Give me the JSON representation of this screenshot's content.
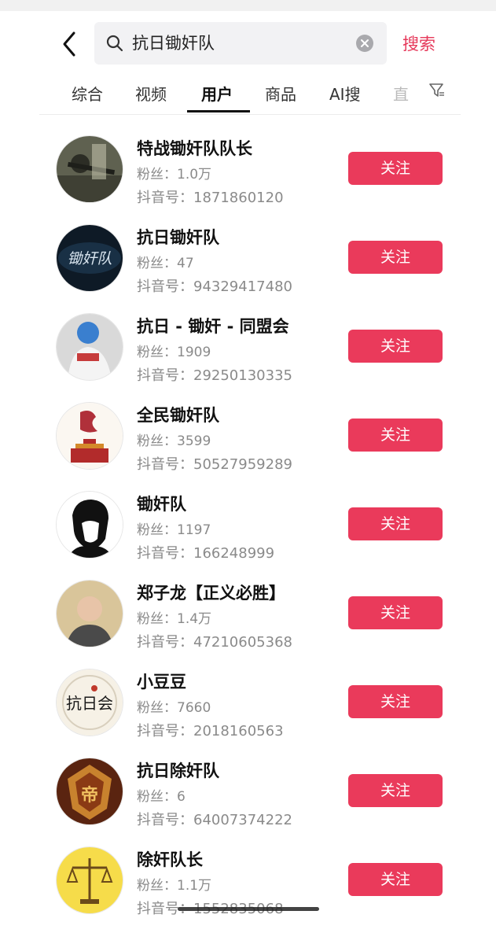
{
  "header": {
    "search_query": "抗日锄奸队",
    "search_button": "搜索"
  },
  "tabs": [
    {
      "label": "综合"
    },
    {
      "label": "视频"
    },
    {
      "label": "用户"
    },
    {
      "label": "商品"
    },
    {
      "label": "AI搜"
    },
    {
      "label": "直"
    }
  ],
  "active_tab": "用户",
  "users": [
    {
      "name": "特战锄奸队队长",
      "fans": "粉丝：1.0万",
      "douyin_id": "抖音号：1871860120",
      "follow": "关注"
    },
    {
      "name": "抗日锄奸队",
      "fans": "粉丝：47",
      "douyin_id": "抖音号：94329417480",
      "follow": "关注"
    },
    {
      "name": "抗日 - 锄奸 - 同盟会",
      "fans": "粉丝：1909",
      "douyin_id": "抖音号：29250130335",
      "follow": "关注"
    },
    {
      "name": "全民锄奸队",
      "fans": "粉丝：3599",
      "douyin_id": "抖音号：50527959289",
      "follow": "关注"
    },
    {
      "name": "锄奸队",
      "fans": "粉丝：1197",
      "douyin_id": "抖音号：166248999",
      "follow": "关注"
    },
    {
      "name": "郑子龙【正义必胜】",
      "fans": "粉丝：1.4万",
      "douyin_id": "抖音号：47210605368",
      "follow": "关注"
    },
    {
      "name": "小豆豆",
      "fans": "粉丝：7660",
      "douyin_id": "抖音号：2018160563",
      "follow": "关注"
    },
    {
      "name": "抗日除奸队",
      "fans": "粉丝：6",
      "douyin_id": "抖音号：64007374222",
      "follow": "关注"
    },
    {
      "name": "除奸队长",
      "fans": "粉丝：1.1万",
      "douyin_id": "抖音号：1552835068",
      "follow": "关注"
    }
  ],
  "avatar_logos": {
    "avatar_2": "锄奸队",
    "avatar_7": "抗日会",
    "avatar_8": "帝"
  },
  "colors": {
    "accent": "#ea3a5b",
    "search_text": "#e6385a"
  },
  "icons": {
    "back": "chevron-left-icon",
    "search": "search-icon",
    "clear": "clear-icon",
    "filter": "filter-icon"
  }
}
